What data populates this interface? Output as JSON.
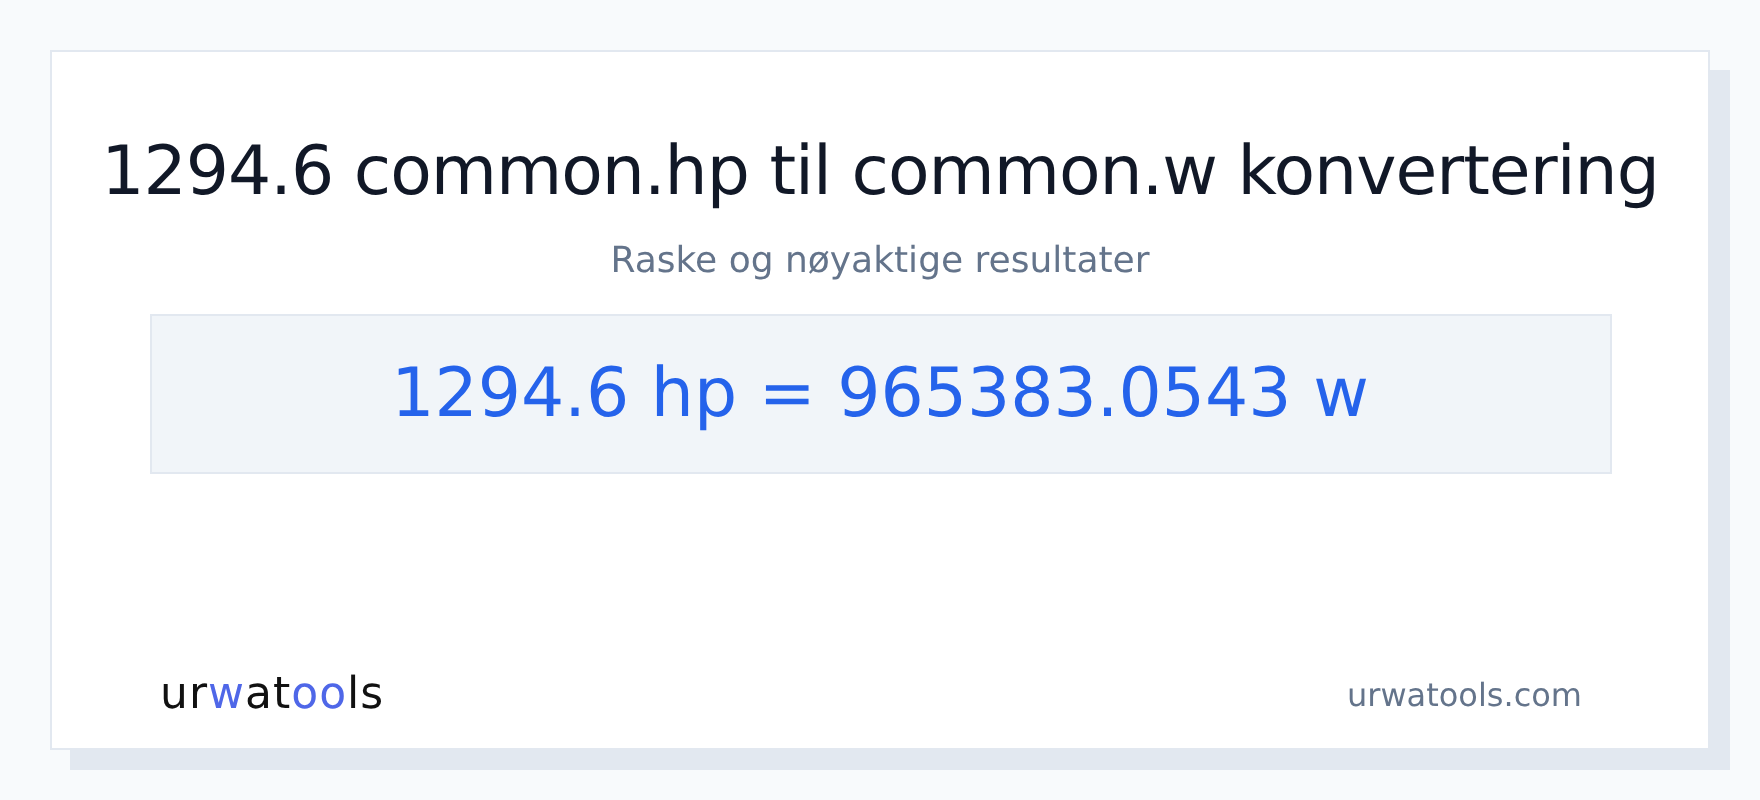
{
  "title": "1294.6 common.hp til common.w konvertering",
  "subtitle": "Raske og nøyaktige resultater",
  "result": "1294.6 hp = 965383.0543 w",
  "logo": [
    {
      "text": "ur",
      "accent": false
    },
    {
      "text": "w",
      "accent": true
    },
    {
      "text": "at",
      "accent": false
    },
    {
      "text": "oo",
      "accent": true
    },
    {
      "text": "ls",
      "accent": false
    }
  ],
  "site": "urwatools.com"
}
